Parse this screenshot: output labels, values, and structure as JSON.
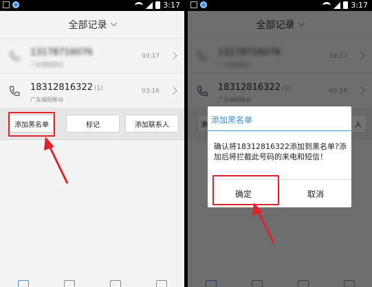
{
  "status_bar": {
    "time": "3:17"
  },
  "header": {
    "title": "全部记录"
  },
  "call_log": [
    {
      "number": "13178716076",
      "count": "",
      "location": "广东揭阳移动",
      "time": "03:17",
      "blurred": true
    },
    {
      "number": "18312816322",
      "count": "(1)",
      "location": "广东揭阳移动",
      "time": "03:16",
      "blurred": false
    }
  ],
  "actions": {
    "blacklist": "添加黑名单",
    "mark": "标记",
    "add_contact": "添加联系人",
    "add_contact_partial": "人",
    "blacklist_partial": "添"
  },
  "dialog": {
    "title": "添加黑名单",
    "message": "确认将18312816322添加到黑名单?添加后将拦截此号码的来电和短信！",
    "confirm": "确定",
    "cancel": "取消"
  },
  "colors": {
    "annotation": "#e0232a",
    "dialog_accent": "#3a8fd8"
  },
  "icons": [
    "phone-icon",
    "chevron-right-icon",
    "chevron-down-icon",
    "dialpad-icon",
    "message-icon",
    "contacts-icon",
    "briefcase-icon"
  ]
}
